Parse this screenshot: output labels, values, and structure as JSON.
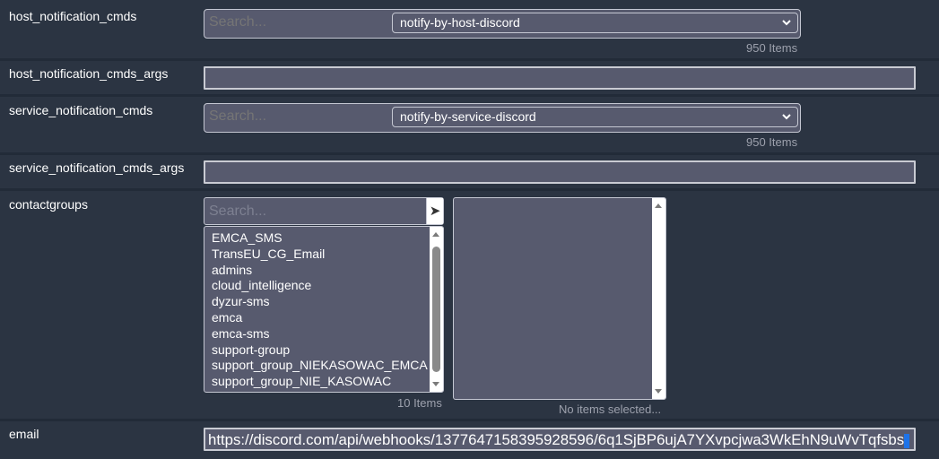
{
  "fields": {
    "host_cmds": {
      "label": "host_notification_cmds",
      "search_placeholder": "Search...",
      "selected": "notify-by-host-discord",
      "count": "950 Items"
    },
    "host_cmds_args": {
      "label": "host_notification_cmds_args",
      "value": ""
    },
    "service_cmds": {
      "label": "service_notification_cmds",
      "search_placeholder": "Search...",
      "selected": "notify-by-service-discord",
      "count": "950 Items"
    },
    "service_cmds_args": {
      "label": "service_notification_cmds_args",
      "value": ""
    },
    "contactgroups": {
      "label": "contactgroups",
      "search_placeholder": "Search...",
      "go_icon": "arrow-right-icon",
      "available": [
        "EMCA_SMS",
        "TransEU_CG_Email",
        "admins",
        "cloud_intelligence",
        "dyzur-sms",
        "emca",
        "emca-sms",
        "support-group",
        "support_group_NIEKASOWAC_EMCA",
        "support_group_NIE_KASOWAC"
      ],
      "available_count": "10 Items",
      "selected_summary": "No items selected..."
    },
    "email": {
      "label": "email",
      "value": "https://discord.com/api/webhooks/1377647158395928596/6q1SjBP6ujA7YXvpcjwa3WkEhN9uWvTqfsbs"
    }
  },
  "colors": {
    "background": "#222b38",
    "row": "#2b3442",
    "input": "#575a6e",
    "muted_text": "#9da1ad",
    "cursor": "#1e73e8"
  }
}
